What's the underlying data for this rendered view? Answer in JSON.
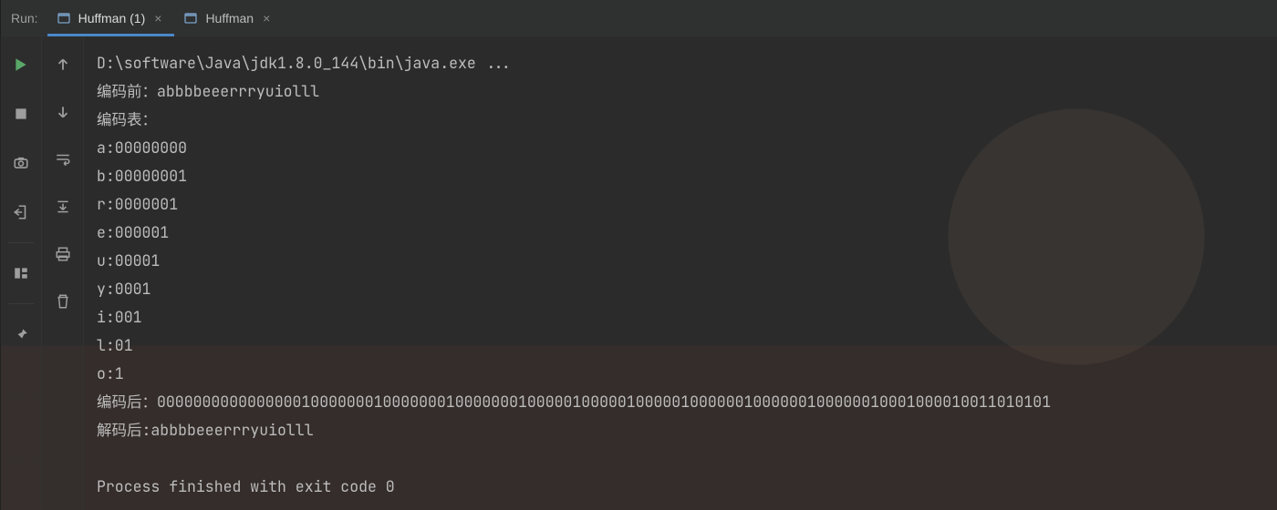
{
  "run_label": "Run:",
  "tabs": [
    {
      "label": "Huffman (1)",
      "active": true
    },
    {
      "label": "Huffman",
      "active": false
    }
  ],
  "left_rail": {
    "run": "run-icon",
    "stop": "stop-icon",
    "dump": "camera-icon",
    "exit": "exit-icon",
    "layout": "layout-icon",
    "pin": "pin-icon"
  },
  "sec_rail": {
    "up": "up-icon",
    "down": "down-icon",
    "wrap": "wrap-icon",
    "scroll": "scroll-end-icon",
    "print": "print-icon",
    "trash": "trash-icon"
  },
  "console": {
    "lines": [
      "D:\\software\\Java\\jdk1.8.0_144\\bin\\java.exe ...",
      "编码前：abbbbeeerrryuiolll",
      "编码表：",
      "a:00000000",
      "b:00000001",
      "r:0000001",
      "e:000001",
      "u:00001",
      "y:0001",
      "i:001",
      "l:01",
      "o:1",
      "编码后：000000000000000010000000100000001000000010000010000010000010000001000000100000010001000010011010101",
      "解码后:abbbbeeerrryuiolll",
      "",
      "Process finished with exit code 0"
    ]
  }
}
